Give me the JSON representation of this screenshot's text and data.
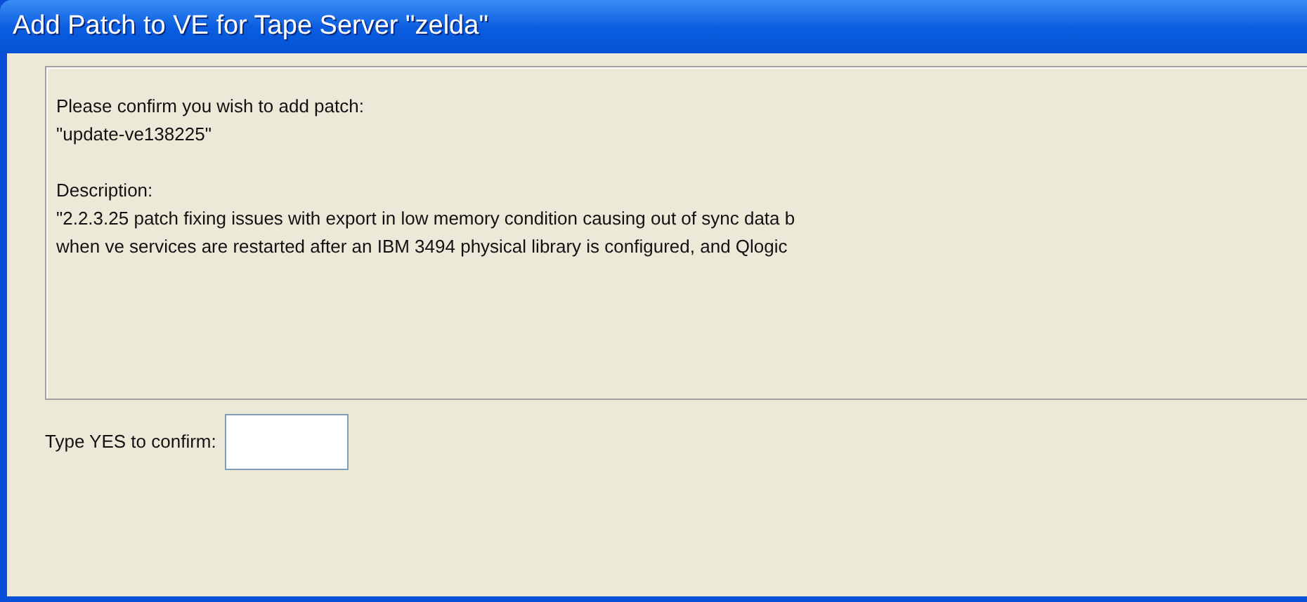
{
  "window": {
    "title": "Add Patch to VE for Tape Server \"zelda\""
  },
  "message": {
    "blocks": [
      [
        "Please confirm you wish to add patch:",
        "\"update-ve138225\""
      ],
      [
        "Description:",
        "\"2.2.3.25 patch fixing issues with export in low memory condition causing out of sync data b",
        "when ve services are restarted after an IBM 3494 physical library is configured, and Qlogic"
      ]
    ]
  },
  "confirm": {
    "label": "Type YES to confirm:"
  }
}
